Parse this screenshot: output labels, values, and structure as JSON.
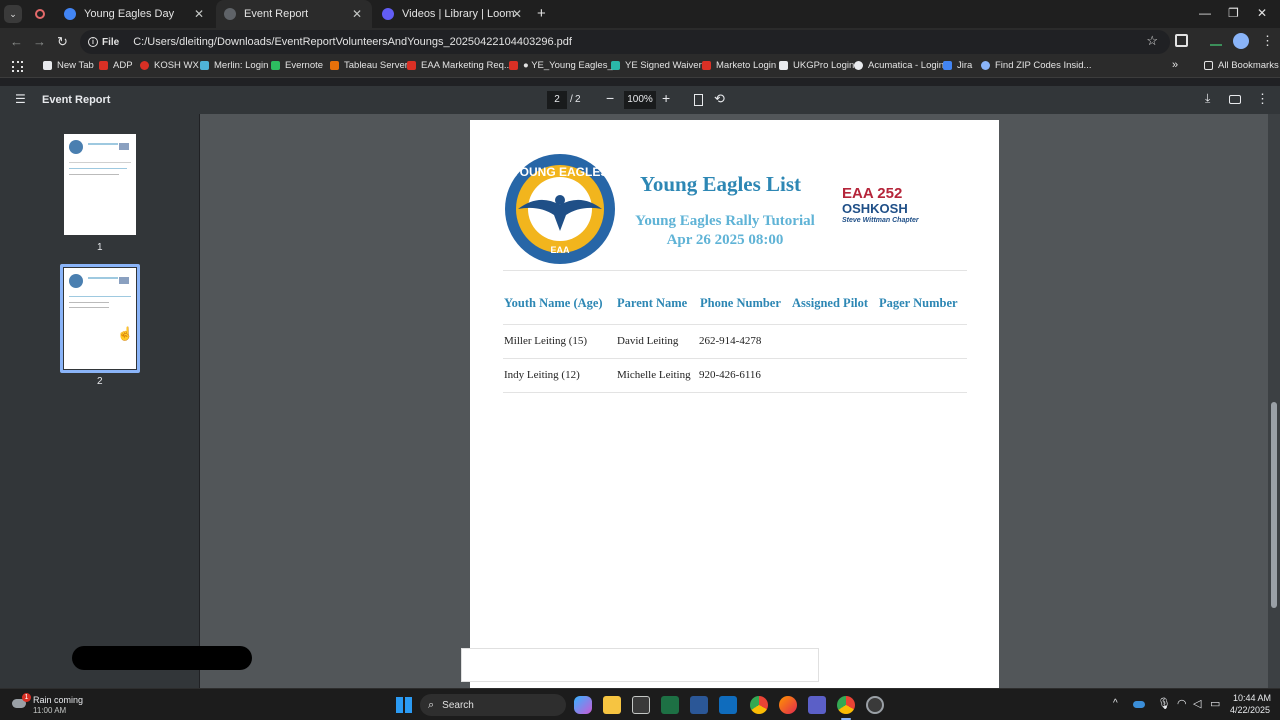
{
  "browser": {
    "tabs": [
      {
        "label": "Young Eagles Day",
        "active": false
      },
      {
        "label": "Event Report",
        "active": true
      },
      {
        "label": "Videos | Library | Loom",
        "active": false
      }
    ],
    "new_tab_glyph": "+",
    "url_chip": "File",
    "url": "C:/Users/dleiting/Downloads/EventReportVolunteersAndYoungs_20250422104403296.pdf",
    "bookmarks": [
      {
        "label": "New Tab",
        "color": "#e8eaed"
      },
      {
        "label": "ADP",
        "color": "#d93025"
      },
      {
        "label": "KOSH WX",
        "color": "#d93025"
      },
      {
        "label": "Merlin: Login",
        "color": "#4fb3d9"
      },
      {
        "label": "Evernote",
        "color": "#2dbe60"
      },
      {
        "label": "Tableau Server",
        "color": "#e8710a"
      },
      {
        "label": "EAA Marketing Req...",
        "color": "#d93025"
      },
      {
        "label": "● YE_Young Eagles_...",
        "color": "#d93025"
      },
      {
        "label": "YE Signed Waivers",
        "color": "#2ab7a9"
      },
      {
        "label": "Marketo Login",
        "color": "#d93025"
      },
      {
        "label": "UKGPro Login",
        "color": "#e8eaed"
      },
      {
        "label": "Acumatica - Login",
        "color": "#e8eaed"
      },
      {
        "label": "Jira",
        "color": "#4285f4"
      },
      {
        "label": "Find ZIP Codes Insid...",
        "color": "#8ab4f8"
      }
    ],
    "all_bookmarks": "All Bookmarks"
  },
  "pdf": {
    "title": "Event Report",
    "current_page": "2",
    "page_sep": "/",
    "total_pages": "2",
    "zoom": "100%",
    "thumbnails": [
      "1",
      "2"
    ]
  },
  "document": {
    "heading": "Young Eagles List",
    "subtitle_line1": "Young Eagles Rally Tutorial",
    "subtitle_line2": "Apr 26 2025 08:00",
    "logo_left": "YOUNG EAGLES",
    "logo_left_bottom": "EAA",
    "logo_right_main": "EAA 252",
    "logo_right_city": "OSHKOSH",
    "logo_right_chapter": "Steve Wittman Chapter",
    "columns": [
      "Youth Name (Age)",
      "Parent Name",
      "Phone Number",
      "Assigned Pilot",
      "Pager Number"
    ],
    "rows": [
      [
        "Miller Leiting (15)",
        "David Leiting",
        "262-914-4278",
        "",
        ""
      ],
      [
        "Indy Leiting (12)",
        "Michelle Leiting",
        "920-426-6116",
        "",
        ""
      ]
    ]
  },
  "taskbar": {
    "weather_title": "Rain coming",
    "weather_time": "11:00 AM",
    "weather_badge": "1",
    "search_placeholder": "Search",
    "time": "10:44 AM",
    "date": "4/22/2025"
  }
}
